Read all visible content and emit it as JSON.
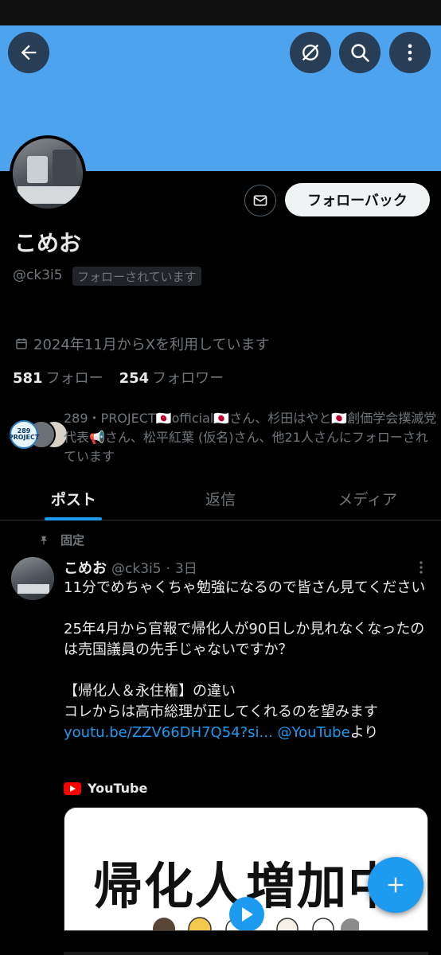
{
  "colors": {
    "banner": "#4ea3ee",
    "accent": "#1d9bf0",
    "background": "#000000",
    "muted_text": "#71767b",
    "primary_text": "#e7e9ea"
  },
  "top_bar": {
    "back_icon": "arrow-left-icon",
    "mute_icon": "no-symbol-icon",
    "search_icon": "search-icon",
    "more_icon": "more-vertical-icon"
  },
  "profile": {
    "display_name": "こめお",
    "handle": "@ck3i5",
    "follows_you_badge": "フォローされています",
    "joined": "2024年11月からXを利用しています",
    "following_count": "581",
    "following_label": "フォロー",
    "followers_count": "254",
    "followers_label": "フォロワー",
    "follow_back_label": "フォローバック",
    "mutual_followers_text": "289・PROJECT🇯🇵official🇯🇵さん、杉田はやと🇯🇵創価学会撲滅党代表📢さん、松平紅葉 (仮名)さん、他21人さんにフォローされています",
    "mutual_badge_text": "289 PROJECT"
  },
  "tabs": [
    {
      "label": "ポスト",
      "active": true
    },
    {
      "label": "返信",
      "active": false
    },
    {
      "label": "メディア",
      "active": false
    }
  ],
  "pinned_label": "固定",
  "post": {
    "author": "こめお",
    "handle": "@ck3i5",
    "separator": "·",
    "time": "3日",
    "text_1": "11分でめちゃくちゃ勉強になるので皆さん見てください\n\n25年4月から官報で帰化人が90日しか見れなくなったのは売国議員の先手じゃないですか？\n\n【帰化人＆永住権】の違い\nコレからは高市総理が正してくれるのを望みます\n",
    "link_url": "youtu.be/ZZV66DH7Q54?si...",
    "space": " ",
    "link_mention": "@YouTube",
    "text_suffix": "より",
    "source_label": "YouTube",
    "video_title": "帰化人増加中"
  },
  "fab_icon": "plus-icon"
}
